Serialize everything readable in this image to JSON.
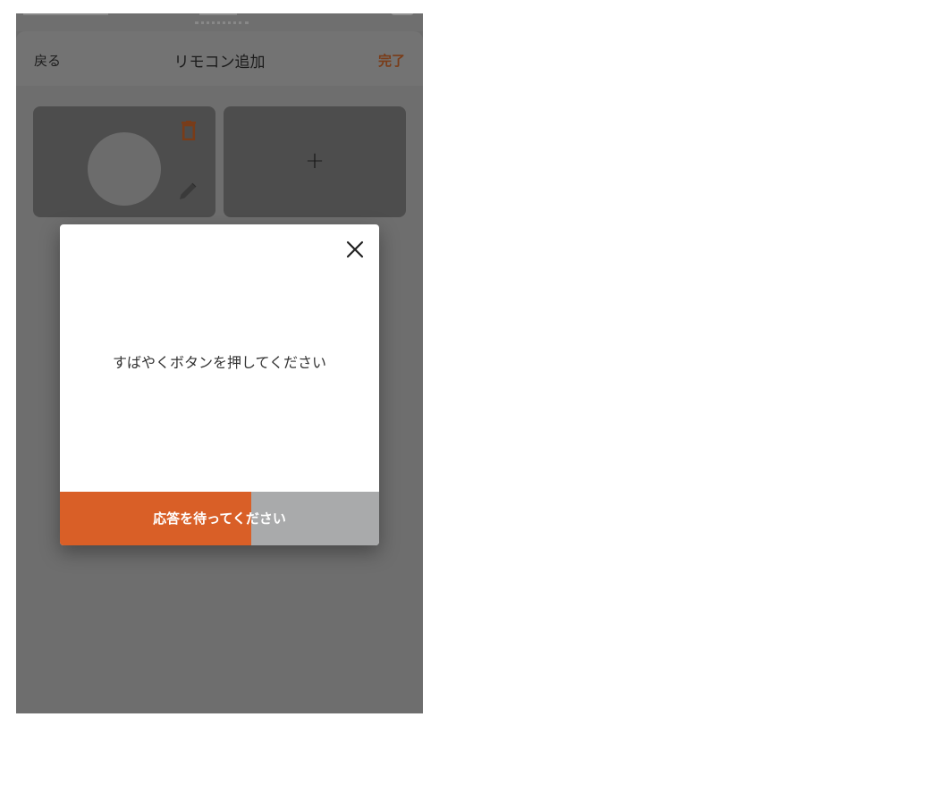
{
  "colors": {
    "accent": "#d95f27",
    "done_text": "#7a3c18",
    "progress_track": "#a9aaab"
  },
  "navbar": {
    "back_label": "戻る",
    "title": "リモコン追加",
    "done_label": "完了"
  },
  "tiles": [
    {
      "icons": [
        "trash-icon",
        "pencil-icon"
      ]
    },
    {
      "add_label": "+"
    }
  ],
  "dialog": {
    "close_icon": "close-icon",
    "message": "すばやくボタンを押してください",
    "progress": {
      "label": "応答を待ってください",
      "fraction": 0.6
    }
  }
}
